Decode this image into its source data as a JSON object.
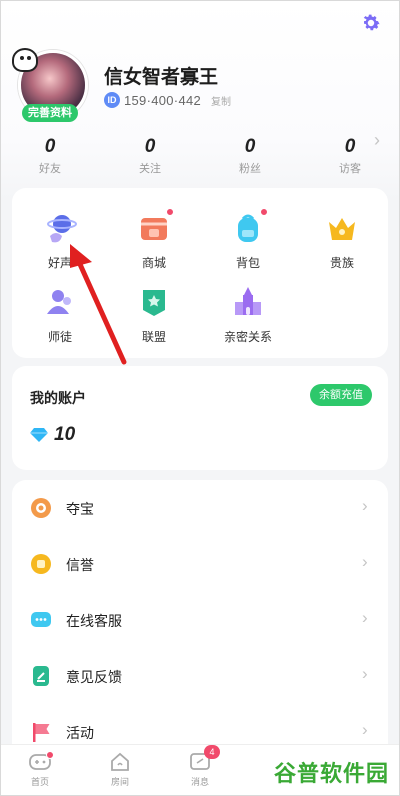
{
  "profile": {
    "nickname": "信女智者寡王",
    "id_label": "ID",
    "id_number": "159·400·442",
    "copy_label": "复制",
    "complete_profile_label": "完善资料"
  },
  "stats": [
    {
      "value": "0",
      "label": "好友"
    },
    {
      "value": "0",
      "label": "关注"
    },
    {
      "value": "0",
      "label": "粉丝"
    },
    {
      "value": "0",
      "label": "访客"
    }
  ],
  "functions": [
    {
      "label": "好声",
      "icon": "voice-planet-icon"
    },
    {
      "label": "商城",
      "icon": "shop-icon"
    },
    {
      "label": "背包",
      "icon": "backpack-icon"
    },
    {
      "label": "贵族",
      "icon": "crown-icon"
    },
    {
      "label": "师徒",
      "icon": "mentor-icon"
    },
    {
      "label": "联盟",
      "icon": "alliance-flag-icon"
    },
    {
      "label": "亲密关系",
      "icon": "castle-icon"
    }
  ],
  "account": {
    "title": "我的账户",
    "recharge_label": "余额充值",
    "balance": "10"
  },
  "menu": [
    {
      "label": "夺宝",
      "icon": "treasure-icon"
    },
    {
      "label": "信誉",
      "icon": "credit-icon"
    },
    {
      "label": "在线客服",
      "icon": "customer-service-icon"
    },
    {
      "label": "意见反馈",
      "icon": "feedback-icon"
    },
    {
      "label": "活动",
      "icon": "flag-icon"
    }
  ],
  "tabs": [
    {
      "label": "首页",
      "icon": "game-controller-icon"
    },
    {
      "label": "房间",
      "icon": "room-icon"
    },
    {
      "label": "消息",
      "icon": "message-icon",
      "badge": "4"
    }
  ],
  "watermark": "谷普软件园",
  "colors": {
    "accent_green": "#2dc86b",
    "badge_red": "#f14a6b",
    "gear": "#7b6cf6",
    "arrow": "#e02020"
  }
}
